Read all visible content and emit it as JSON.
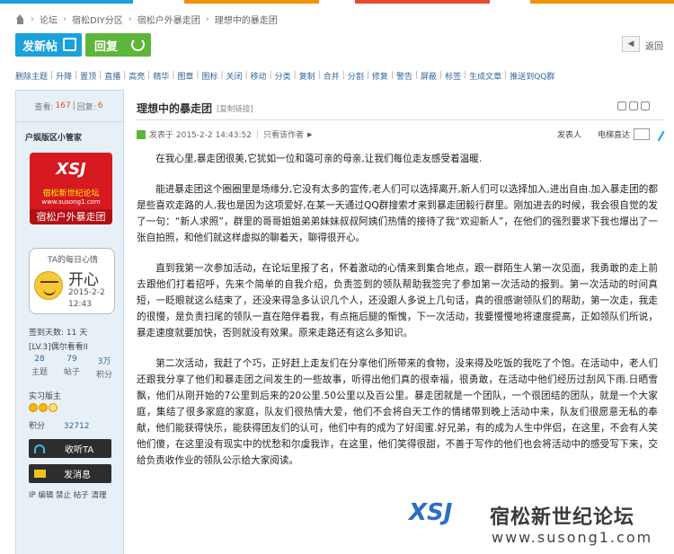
{
  "topbar": {
    "stripe_colors": [
      "#1aa0dc",
      "#f39200",
      "#e64b32",
      "#f39200"
    ]
  },
  "breadcrumb": {
    "items": [
      "论坛",
      "宿松DIY分区",
      "宿松户外暴走团",
      "理想中的暴走团"
    ]
  },
  "actions": {
    "post_label": "发新帖",
    "reply_label": "回复",
    "back_label": "返回"
  },
  "admin_bar": {
    "items": [
      "删除主题",
      "升降",
      "置顶",
      "直播",
      "高亮",
      "精华",
      "图章",
      "图标",
      "关闭",
      "移动",
      "分类",
      "复制",
      "合并",
      "分割",
      "修复",
      "警告",
      "屏蔽",
      "标签",
      "生成文章",
      "推送到QQ群"
    ]
  },
  "stats": {
    "views_label": "查看:",
    "views": "167",
    "replies_label": "回复:",
    "replies": "6"
  },
  "author": {
    "name": "户娱版区小管家",
    "avatar": {
      "logo": "XSJ",
      "line1": "宿松新世纪论坛",
      "line2": "www.susong1.com",
      "banner": "宿松户外暴走团"
    },
    "mood": {
      "title": "TA的每日心情",
      "word": "开心",
      "date": "2015-2-2",
      "time": "12:43"
    },
    "sign_days": "签到天数: 11 天",
    "level": "[LV.3]偶尔看看II",
    "counts": [
      {
        "value": "28",
        "label": "主题"
      },
      {
        "value": "79",
        "label": "帖子"
      },
      {
        "value": "3万",
        "label": "积分"
      }
    ],
    "medal_label": "实习版主",
    "score_label": "积分",
    "score": "32712",
    "listen_label": "收听TA",
    "message_label": "发消息",
    "ip_links": "IP 编辑 禁止 帖子 清理"
  },
  "post": {
    "title": "理想中的暴走团",
    "copy_link": "[复制链接]",
    "meta_posted": "发表于 2015-2-2 14:43:52",
    "meta_only_author": "只看该作者",
    "meta_poster": "发表人",
    "meta_tv": "电梯直达",
    "paragraphs": [
      "在我心里,暴走团很美,它犹如一位和蔼可亲的母亲,让我们每位走友感受着温暖.",
      "能进暴走团这个圈圈里是场缘分,它没有太多的宣传,老人们可以选择离开,新人们可以选择加入,进出自由.加入暴走团的都是些喜欢走路的人,我也是因为这项爱好,在某一天通过QQ群搜索才来到暴走团毅行群里。刚加进去的时候，我会很自觉的发了一句：“新人求照”，群里的哥哥姐姐弟弟妹妹叔叔阿姨们热情的接待了我“欢迎新人”，在他们的强烈要求下我也爆出了一张自拍照，和他们就这样虚拟的聊着天，聊得很开心。",
      "直到我第一次参加活动，在论坛里报了名，怀着激动的心情来到集合地点，跟一群陌生人第一次见面，我勇敢的走上前去跟他们打着招呼，先来个简单的自我介绍，负责签到的领队帮助我签完了参加第一次活动的报到。第一次活动的时间真短，一眨眼就这么结束了，还没来得急多认识几个人，还没跟人多说上几句话，真的很感谢领队们的帮助，第一次走，我走的很慢，是负责扫尾的领队一直在陪伴着我，有点拖后腿的惭愧，下一次活动，我要慢慢地将速度提高，正如领队们所说，暴走速度就要加快，否则就没有效果。原来走路还有这么多知识。",
      "第二次活动，我赶了个巧，正好赶上走友们在分享他们所带来的食物，没来得及吃饭的我吃了个饱。在活动中，老人们还跟我分享了他们和暴走团之间发生的一些故事，听得出他们真的很幸福，很勇敢，在活动中他们经历过刮风下雨.日晒雪飘，他们从刚开始的7公里到后来的20公里.50公里以及百公里。暴走团就是一个团队，一个很团结的团队，就是一个大家庭，集结了很多家庭的家庭，队友们很热情大爱，他们不会将自天工作的情绪带到晚上活动中来，队友们很愿意无私的奉献，他们能获得快乐，能获得团友们的认可，他们中有的成为了好闺蜜.好兄弟，有的成为人生中伴侣，在这里，不会有人笑他们傻，在这里没有现实中的忧愁和尔虞我诈，在这里，他们笑得很甜，不善于写作的他们也会将活动中的感受写下来，交给负责收作业的领队公示给大家阅读。"
    ]
  },
  "watermark": {
    "logo": "XSJ",
    "name": "宿松新世纪论坛",
    "url": "www.susong1.com"
  }
}
